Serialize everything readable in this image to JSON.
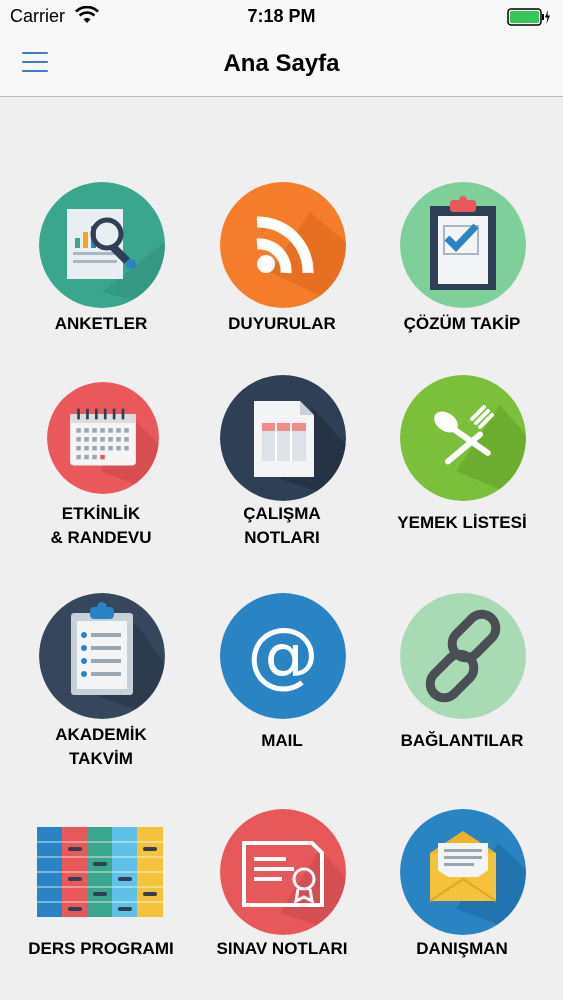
{
  "status_bar": {
    "carrier": "Carrier",
    "time": "7:18 PM"
  },
  "nav": {
    "title": "Ana Sayfa"
  },
  "tiles": [
    {
      "label": "ANKETLER",
      "icon": "survey-icon",
      "color": "#3aa68e"
    },
    {
      "label": "DUYURULAR",
      "icon": "rss-icon",
      "color": "#f57c2b"
    },
    {
      "label": "ÇÖZÜM TAKİP",
      "icon": "clipboard-check-icon",
      "color": "#7fcf9a"
    },
    {
      "label": "ETKİNLİK\n& RANDEVU",
      "icon": "calendar-icon",
      "color": "#e9595b"
    },
    {
      "label": "ÇALIŞMA\nNOTLARI",
      "icon": "document-icon",
      "color": "#2f3f55"
    },
    {
      "label": "YEMEK LİSTESİ",
      "icon": "fork-spoon-icon",
      "color": "#7bbf3a"
    },
    {
      "label": "AKADEMİK\nTAKVİM",
      "icon": "checklist-icon",
      "color": "#36475d"
    },
    {
      "label": "MAIL",
      "icon": "at-sign-icon",
      "color": "#2a83c3"
    },
    {
      "label": "BAĞLANTILAR",
      "icon": "chain-link-icon",
      "color": "#a8dab4"
    },
    {
      "label": "DERS PROGRAMI",
      "icon": "schedule-grid-icon",
      "color": "#ffffff"
    },
    {
      "label": "SINAV NOTLARI",
      "icon": "certificate-icon",
      "color": "#e6585a"
    },
    {
      "label": "DANIŞMAN",
      "icon": "envelope-icon",
      "color": "#2a83c3"
    }
  ]
}
